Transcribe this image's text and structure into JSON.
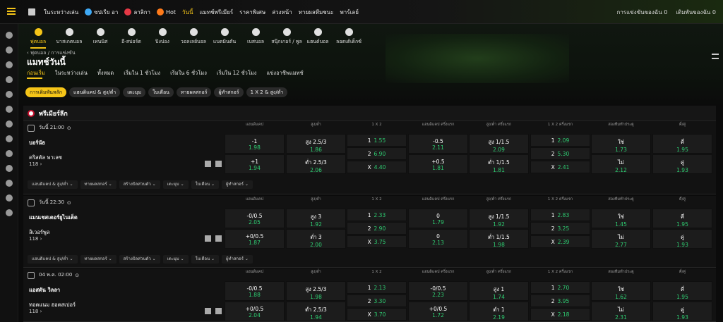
{
  "topbar": {
    "items": [
      {
        "label": "",
        "icon": "home-icon"
      },
      {
        "label": "ในระหว่างเล่น",
        "icon": ""
      },
      {
        "label": "ซปเรีย อา",
        "icon": "globe-icon"
      },
      {
        "label": "ลาลิกา",
        "icon": "laliga-icon"
      },
      {
        "label": "Hot",
        "icon": "fire-icon"
      },
      {
        "label": "วันนี้",
        "icon": ""
      },
      {
        "label": "แมทช์พรีเมียร์",
        "icon": ""
      },
      {
        "label": "ราคาพิเศษ",
        "icon": ""
      },
      {
        "label": "ล่วงหน้า",
        "icon": ""
      },
      {
        "label": "ทายผลทีมชนะ",
        "icon": ""
      },
      {
        "label": "พาร์เลย์",
        "icon": ""
      }
    ],
    "right": [
      "การแข่งขันของฉัน 0",
      "เดิมพันของฉัน 0"
    ]
  },
  "sports": [
    {
      "label": "ฟุตบอล",
      "icon": "football-icon",
      "active": true
    },
    {
      "label": "บาสเกตบอล",
      "icon": "basketball-icon"
    },
    {
      "label": "เทนนิส",
      "icon": "tennis-icon"
    },
    {
      "label": "อี-สปอร์ต",
      "icon": "esports-icon"
    },
    {
      "label": "ปิงปอง",
      "icon": "table-tennis-icon"
    },
    {
      "label": "วอลเลย์บอล",
      "icon": "volleyball-icon"
    },
    {
      "label": "แบดมินตัน",
      "icon": "badminton-icon"
    },
    {
      "label": "เบสบอล",
      "icon": "baseball-icon"
    },
    {
      "label": "สนุ๊กเกอร์ / พูล",
      "icon": "snooker-icon"
    },
    {
      "label": "แฮนด์บอล",
      "icon": "handball-icon"
    },
    {
      "label": "ลอตเต้เด็กซ์",
      "icon": "lotto-icon"
    }
  ],
  "breadcrumb": "‹ ฟุตบอล / การแข่งขัน",
  "page_title": "แมทช์วันนี้",
  "time_tabs": [
    "ก่อนเริ่ม",
    "ในระหว่างเล่น",
    "ทั้งหมด",
    "เริ่มใน 1 ชั่วโมง",
    "เริ่มใน 6 ชั่วโมง",
    "เริ่มใน 12 ชั่วโมง",
    "แข่งอาชีพแมทช์"
  ],
  "chips": [
    "การเดิมพันหลัก",
    "แฮนดิแคป & สูง/ต่ำ",
    "เตะมุม",
    "ใบเตือน",
    "ทายผลสกอร์",
    "ผู้ทำสกอร์",
    "1 X 2 & สูง/ต่ำ"
  ],
  "league": "พรีเมียร์ลีก",
  "col_headers": [
    "แฮนดิแคป",
    "สูง/ต่ำ",
    "1 X 2",
    "แฮนดิแคป ครึ่งแรก",
    "สูง/ต่ำ ครึ่งแรก",
    "1 X 2 ครึ่งแรก",
    "สองทีมทำประตู",
    "คี่/คู่"
  ],
  "market_tabs": [
    "แฮนดิแคป & สูง/ต่ำ",
    "ทายผลสกอร์",
    "สร้างบิลส่วนตัว",
    "เตะมุม",
    "ใบเตือน",
    "ผู้ทำสกอร์"
  ],
  "matches": [
    {
      "time": "วันนี้ 21:00",
      "home": "บอร์นัธ",
      "away": "คริสตัล พาเลซ",
      "more": "118 ›",
      "hdp": [
        {
          "line": "-1",
          "odds": "1.98"
        },
        {
          "line": "+1",
          "odds": "1.94"
        }
      ],
      "ou": [
        {
          "line": "สูง 2.5/3",
          "odds": "1.86"
        },
        {
          "line": "ต่ำ 2.5/3",
          "odds": "2.06"
        }
      ],
      "x12": [
        {
          "l": "1",
          "o": "1.55"
        },
        {
          "l": "2",
          "o": "6.90"
        },
        {
          "l": "X",
          "o": "4.40"
        }
      ],
      "hdp1": [
        {
          "line": "-0.5",
          "odds": "2.11"
        },
        {
          "line": "+0.5",
          "odds": "1.81"
        }
      ],
      "ou1": [
        {
          "line": "สูง 1/1.5",
          "odds": "2.09"
        },
        {
          "line": "ต่ำ 1/1.5",
          "odds": "1.81"
        }
      ],
      "x121": [
        {
          "l": "1",
          "o": "2.09"
        },
        {
          "l": "2",
          "o": "5.30"
        },
        {
          "l": "X",
          "o": "2.41"
        }
      ],
      "btts": [
        {
          "line": "ใช่",
          "odds": "1.73"
        },
        {
          "line": "ไม่",
          "odds": "2.12"
        }
      ],
      "oe": [
        {
          "line": "คี่",
          "odds": "1.95"
        },
        {
          "line": "คู่",
          "odds": "1.93"
        }
      ]
    },
    {
      "time": "วันนี้ 22:30",
      "home": "แมนเชสเตอร์ยูไนเต็ด",
      "away": "ลิเวอร์พูล",
      "more": "118 ›",
      "hdp": [
        {
          "line": "-0/0.5",
          "odds": "2.05"
        },
        {
          "line": "+0/0.5",
          "odds": "1.87"
        }
      ],
      "ou": [
        {
          "line": "สูง 3",
          "odds": "1.92"
        },
        {
          "line": "ต่ำ 3",
          "odds": "2.00"
        }
      ],
      "x12": [
        {
          "l": "1",
          "o": "2.33"
        },
        {
          "l": "2",
          "o": "2.90"
        },
        {
          "l": "X",
          "o": "3.75"
        }
      ],
      "hdp1": [
        {
          "line": "0",
          "odds": "1.79"
        },
        {
          "line": "0",
          "odds": "2.13"
        }
      ],
      "ou1": [
        {
          "line": "สูง 1/1.5",
          "odds": "1.92"
        },
        {
          "line": "ต่ำ 1/1.5",
          "odds": "1.98"
        }
      ],
      "x121": [
        {
          "l": "1",
          "o": "2.83"
        },
        {
          "l": "2",
          "o": "3.25"
        },
        {
          "l": "X",
          "o": "2.39"
        }
      ],
      "btts": [
        {
          "line": "ใช่",
          "odds": "1.45"
        },
        {
          "line": "ไม่",
          "odds": "2.77"
        }
      ],
      "oe": [
        {
          "line": "คี่",
          "odds": "1.95"
        },
        {
          "line": "คู่",
          "odds": "1.93"
        }
      ]
    },
    {
      "time": "04 พ.ค. 02:00",
      "home": "แอสตัน วิลลา",
      "away": "ทอตแนม ฮอตสเปอร์",
      "more": "118 ›",
      "hdp": [
        {
          "line": "-0/0.5",
          "odds": "1.88"
        },
        {
          "line": "+0/0.5",
          "odds": "2.04"
        }
      ],
      "ou": [
        {
          "line": "สูง 2.5/3",
          "odds": "1.98"
        },
        {
          "line": "ต่ำ 2.5/3",
          "odds": "1.94"
        }
      ],
      "x12": [
        {
          "l": "1",
          "o": "2.13"
        },
        {
          "l": "2",
          "o": "3.30"
        },
        {
          "l": "X",
          "o": "3.70"
        }
      ],
      "hdp1": [
        {
          "line": "-0/0.5",
          "odds": "2.23"
        },
        {
          "line": "+0/0.5",
          "odds": "1.72"
        }
      ],
      "ou1": [
        {
          "line": "สูง 1",
          "odds": "1.74"
        },
        {
          "line": "ต่ำ 1",
          "odds": "2.19"
        }
      ],
      "x121": [
        {
          "l": "1",
          "o": "2.70"
        },
        {
          "l": "2",
          "o": "3.95"
        },
        {
          "l": "X",
          "o": "2.18"
        }
      ],
      "btts": [
        {
          "line": "ใช่",
          "odds": "1.62"
        },
        {
          "line": "ไม่",
          "odds": "2.31"
        }
      ],
      "oe": [
        {
          "line": "คี่",
          "odds": "1.95"
        },
        {
          "line": "คู่",
          "odds": "1.93"
        }
      ]
    }
  ],
  "colors": {
    "accent": "#f5c518",
    "odds": "#2ecc71",
    "bg": "#0b0b0b"
  }
}
